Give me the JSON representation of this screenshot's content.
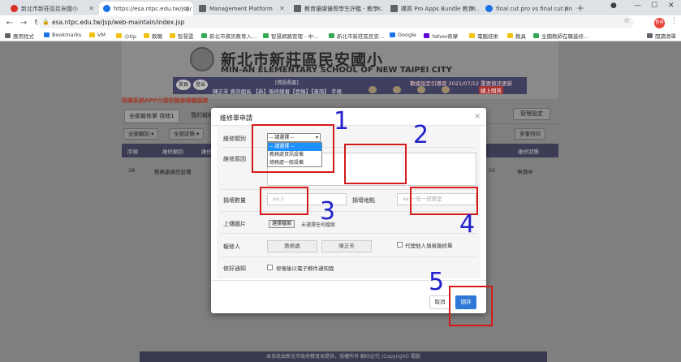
{
  "browser": {
    "tabs": [
      {
        "label": "新北市新莊區民安國小",
        "active": false
      },
      {
        "label": "https://esa.ntpc.edu.tw/jsp/",
        "active": true
      },
      {
        "label": "Management Platform",
        "active": false
      },
      {
        "label": "教育優課優質學生評鑑 - 教學...",
        "active": false
      },
      {
        "label": "購買 Pro Apps Bundle 教育...",
        "active": false
      },
      {
        "label": "final cut pro vs final cut pro...",
        "active": false
      }
    ],
    "url": "esa.ntpc.edu.tw/jsp/web-maintain/index.jsp",
    "avatar_text": "暫停",
    "bookmarks": [
      "應用程式",
      "Bookmarks",
      "VM",
      "小tip",
      "教職",
      "智慧雲",
      "新北市資訊教育入...",
      "智慧網路管理 - 中...",
      "新北市新莊區民安...",
      "Google",
      "Yahoo奇摩",
      "電腦技術",
      "教具",
      "全國教師在職進修...",
      "閱讀清單"
    ]
  },
  "page": {
    "school_name": "新北市新莊區民安國小",
    "school_name_en": "MIN-AN ELEMENTARY SCHOOL OF NEW TAIPEI CITY",
    "nav_buttons": [
      "首頁",
      "登出"
    ],
    "strip_title": "[資訊長區]",
    "strip_user": "陳正芳 資訊組長 【新】報修總督【登錄】【查詢】 手冊",
    "strip_right": "數據設定引導頁 2021/07/12 重要資訊更新",
    "login_btn": "線上問答",
    "notice": "校園系統APP介接供報修填報服務",
    "tabs": [
      "全部報修單 待修1",
      "我的報修"
    ],
    "manage_btn": "管理設定",
    "filters": [
      "全部類別 ▾",
      "全部狀態 ▾"
    ],
    "extra_btn": "多筆列印",
    "table_headers": [
      "序號",
      "維修類別",
      "維修原因",
      "維修狀態"
    ],
    "row": {
      "id": "28",
      "category": "教務處資訊設備",
      "date": "02",
      "status": "申請中"
    },
    "footer": "本系統由新北市政府教育局提供，版權所有 翻印必究 (Copyright) 電腦"
  },
  "modal": {
    "title": "維修單申請",
    "labels": {
      "category": "維修類別",
      "reason": "維修原因",
      "quantity": "損壞數量",
      "location": "損壞地點",
      "upload": "上傳圖片",
      "reporter": "報修人",
      "notify": "修好通知"
    },
    "category_select": "-- 請選擇 --",
    "category_options": [
      "-- 請選擇 --",
      "教務處資訊設備",
      "總務處一般設備"
    ],
    "quantity_placeholder": "ex:1",
    "location_placeholder": "ex:一年一班教室",
    "file_button": "選擇檔案",
    "file_text": "未選擇任何檔案",
    "reporter_unit": "教務處",
    "reporter_name": "陳正芳",
    "proxy_label": "代理他人填寫報修單",
    "notify_label": "修復後以電子郵件通知我",
    "cancel": "取消",
    "save": "儲存"
  },
  "annotations": [
    "1",
    "2",
    "3",
    "4",
    "5"
  ],
  "colors": {
    "annotation_box": "#d41a1a",
    "annotation_number": "#2222cc",
    "save_button": "#2e79d6"
  }
}
